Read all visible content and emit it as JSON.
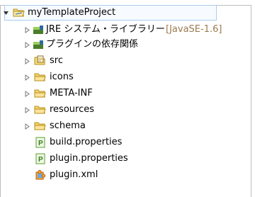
{
  "colors": {
    "selection_border": "#a9cdee",
    "selection_fill": "#f7fbff",
    "folder": "#e8c34a",
    "library": "#6b8e23",
    "decoration": "#9a7b4f",
    "properties": "#5aa02c",
    "xml": "#d35400"
  },
  "tree": {
    "project": {
      "label": "myTemplateProject",
      "icon": "project-folder-icon",
      "expanded": true
    },
    "children": [
      {
        "label": "JRE システム・ライブラリー",
        "decoration": "[JavaSE-1.6]",
        "icon": "library-icon",
        "expanded": false
      },
      {
        "label": "プラグインの依存関係",
        "icon": "library-icon",
        "expanded": false
      },
      {
        "label": "src",
        "icon": "source-folder-icon",
        "expanded": false
      },
      {
        "label": "icons",
        "icon": "folder-icon",
        "expanded": false
      },
      {
        "label": "META-INF",
        "icon": "folder-icon",
        "expanded": false
      },
      {
        "label": "resources",
        "icon": "folder-icon",
        "expanded": false
      },
      {
        "label": "schema",
        "icon": "folder-icon",
        "expanded": false
      },
      {
        "label": "build.properties",
        "icon": "properties-file-icon"
      },
      {
        "label": "plugin.properties",
        "icon": "properties-file-icon"
      },
      {
        "label": "plugin.xml",
        "icon": "plugin-xml-icon"
      }
    ]
  }
}
